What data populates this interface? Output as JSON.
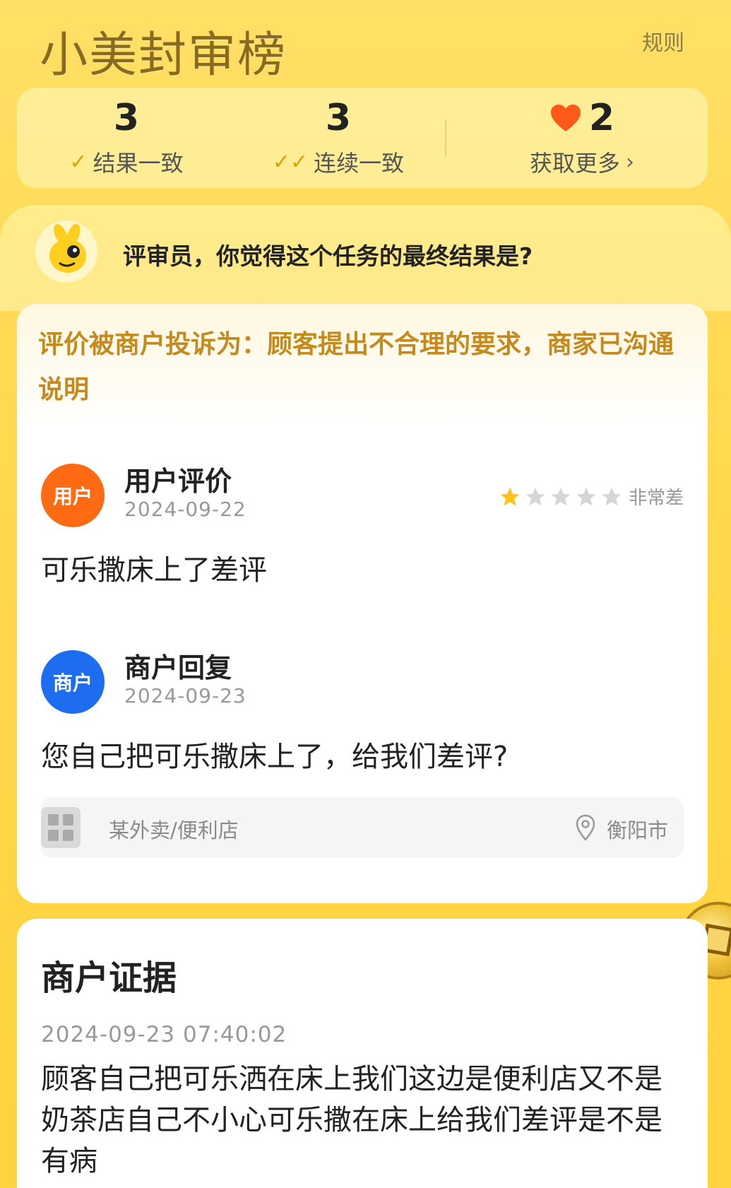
{
  "header": {
    "title": "小美封审榜",
    "rules_label": "规则"
  },
  "stats": {
    "result_match": {
      "value": "3",
      "label": "结果一致"
    },
    "streak_match": {
      "value": "3",
      "label": "连续一致"
    },
    "lives": {
      "value": "2",
      "label": "获取更多",
      "chevron": "›"
    }
  },
  "question": {
    "text": "评审员，你觉得这个任务的最终结果是?"
  },
  "complaint": {
    "text": "评价被商户投诉为：顾客提出不合理的要求，商家已沟通说明"
  },
  "user_review": {
    "avatar_label": "用户",
    "title": "用户评价",
    "date": "2024-09-22",
    "rating": 1,
    "rating_max": 5,
    "rating_label": "非常差",
    "text": "可乐撒床上了差评"
  },
  "merchant_reply": {
    "avatar_label": "商户",
    "title": "商户回复",
    "date": "2024-09-23",
    "text": "您自己把可乐撒床上了，给我们差评?"
  },
  "store": {
    "name": "某外卖/便利店",
    "city": "衡阳市"
  },
  "evidence": {
    "title": "商户证据",
    "timestamp": "2024-09-23 07:40:02",
    "text": "顾客自己把可乐洒在床上我们这边是便利店又不是奶茶店自己不小心可乐撒在床上给我们差评是不是有病"
  },
  "colors": {
    "background": "#ffd94d",
    "user_avatar": "#ff6a13",
    "merchant_avatar": "#1e6cf0",
    "complaint_text": "#c58a1e",
    "heart": "#ff5a1a",
    "star_active": "#ffc21a",
    "star_inactive": "#d6d6d6"
  },
  "icons": {
    "check": "check-icon",
    "double_check": "double-check-icon",
    "heart": "heart-icon",
    "star": "star-icon",
    "pin": "location-pin-icon",
    "mascot": "mascot-icon",
    "coin": "coin-icon",
    "store": "store-thumbnail-icon"
  }
}
